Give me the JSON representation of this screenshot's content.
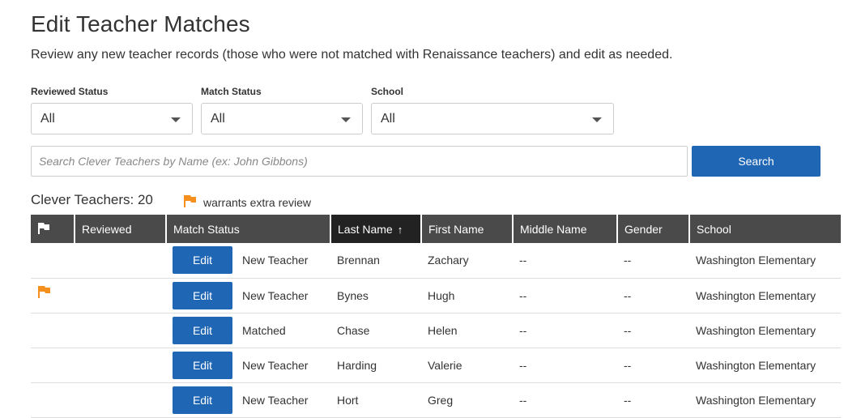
{
  "page": {
    "title": "Edit Teacher Matches",
    "description": "Review any new teacher records (those who were not matched with Renaissance teachers) and edit as needed."
  },
  "filters": [
    {
      "label": "Reviewed Status",
      "value": "All"
    },
    {
      "label": "Match Status",
      "value": "All"
    },
    {
      "label": "School",
      "value": "All"
    }
  ],
  "search": {
    "placeholder": "Search Clever Teachers by Name (ex: John Gibbons)",
    "button_label": "Search"
  },
  "summary": {
    "count_label": "Clever Teachers: 20",
    "legend_text": "warrants extra review"
  },
  "table": {
    "headers": {
      "reviewed": "Reviewed",
      "match_status": "Match Status",
      "last_name": "Last Name",
      "first_name": "First Name",
      "middle_name": "Middle Name",
      "gender": "Gender",
      "school": "School"
    },
    "sort_arrow": "↑",
    "edit_label": "Edit",
    "rows": [
      {
        "flagged": false,
        "match_status": "New Teacher",
        "last_name": "Brennan",
        "first_name": "Zachary",
        "middle_name": "--",
        "gender": "--",
        "school": "Washington Elementary"
      },
      {
        "flagged": true,
        "match_status": "New Teacher",
        "last_name": "Bynes",
        "first_name": "Hugh",
        "middle_name": "--",
        "gender": "--",
        "school": "Washington Elementary"
      },
      {
        "flagged": false,
        "match_status": "Matched",
        "last_name": "Chase",
        "first_name": "Helen",
        "middle_name": "--",
        "gender": "--",
        "school": "Washington Elementary"
      },
      {
        "flagged": false,
        "match_status": "New Teacher",
        "last_name": "Harding",
        "first_name": "Valerie",
        "middle_name": "--",
        "gender": "--",
        "school": "Washington Elementary"
      },
      {
        "flagged": false,
        "match_status": "New Teacher",
        "last_name": "Hort",
        "first_name": "Greg",
        "middle_name": "--",
        "gender": "--",
        "school": "Washington Elementary"
      }
    ]
  },
  "colors": {
    "primary_button": "#1f66b5",
    "header_bg": "#4a4a4a",
    "sorted_header_bg": "#222222",
    "flag_orange": "#f5901e"
  },
  "icons": {
    "header_flag": "flag-icon",
    "row_flag": "flag-icon",
    "select_caret": "caret-down-icon",
    "sort": "arrow-up-icon"
  }
}
